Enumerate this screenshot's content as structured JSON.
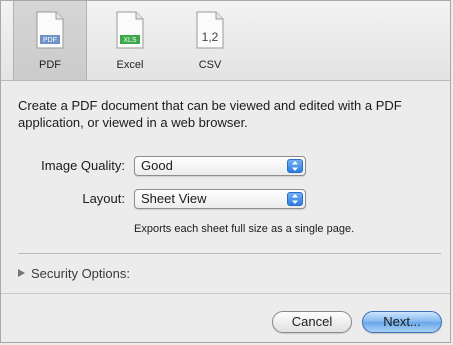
{
  "tabs": [
    {
      "label": "PDF",
      "icon": "pdf-document-icon",
      "selected": true
    },
    {
      "label": "Excel",
      "icon": "excel-document-icon",
      "selected": false
    },
    {
      "label": "CSV",
      "icon": "csv-document-icon",
      "selected": false
    }
  ],
  "icon_text": {
    "pdf": "PDF",
    "excel": "XLS",
    "csv": "1,2"
  },
  "description": "Create a PDF document that can be viewed and edited with a PDF application, or viewed in a web browser.",
  "image_quality": {
    "label": "Image Quality:",
    "value": "Good"
  },
  "layout": {
    "label": "Layout:",
    "value": "Sheet View"
  },
  "layout_note": "Exports each sheet full size as a single page.",
  "security_options": {
    "label": "Security Options:",
    "expanded": false
  },
  "buttons": {
    "cancel": "Cancel",
    "next": "Next..."
  },
  "colors": {
    "accent": "#2f7de2",
    "excel_green": "#3aa84a",
    "pdf_blue": "#6f93c7"
  }
}
